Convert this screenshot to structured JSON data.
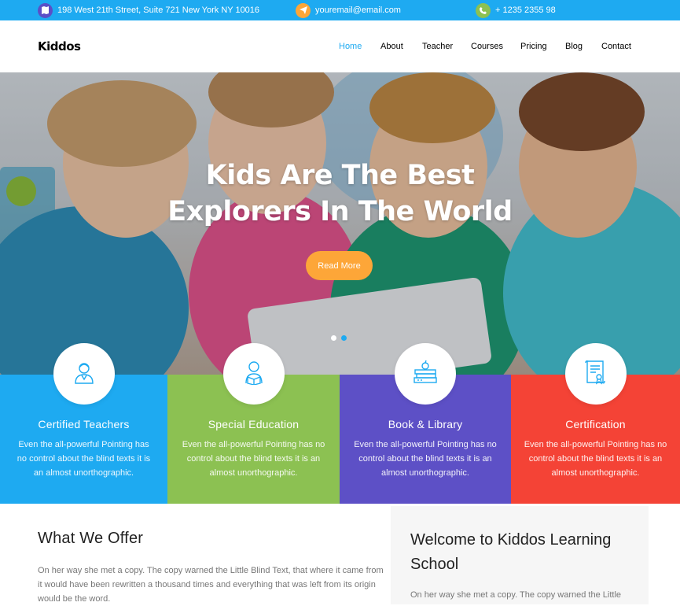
{
  "topbar": {
    "address": "198 West 21th Street, Suite 721 New York NY 10016",
    "email": "youremail@email.com",
    "phone": "+ 1235 2355 98",
    "icons": {
      "address": {
        "name": "map-icon",
        "color": "#5b4fc7"
      },
      "email": {
        "name": "paper-plane-icon",
        "color": "#fda638"
      },
      "phone": {
        "name": "phone-icon",
        "color": "#8cc152"
      }
    }
  },
  "navbar": {
    "brand": "Kiddos",
    "items": [
      {
        "label": "Home",
        "active": true
      },
      {
        "label": "About"
      },
      {
        "label": "Teacher"
      },
      {
        "label": "Courses"
      },
      {
        "label": "Pricing"
      },
      {
        "label": "Blog"
      },
      {
        "label": "Contact"
      }
    ]
  },
  "hero": {
    "title_line1": "Kids Are The Best",
    "title_line2": "Explorers In The World",
    "button": "Read More",
    "slide_count": 2,
    "active_slide": 2
  },
  "services": [
    {
      "title": "Certified Teachers",
      "text": "Even the all-powerful Pointing has no control about the blind texts it is an almost unorthographic.",
      "color": "#1eaaf1",
      "icon": "teacher-icon"
    },
    {
      "title": "Special Education",
      "text": "Even the all-powerful Pointing has no control about the blind texts it is an almost unorthographic.",
      "color": "#8cc152",
      "icon": "student-reading-icon"
    },
    {
      "title": "Book & Library",
      "text": "Even the all-powerful Pointing has no control about the blind texts it is an almost unorthographic.",
      "color": "#5d50c6",
      "icon": "books-apple-icon"
    },
    {
      "title": "Certification",
      "text": "Even the all-powerful Pointing has no control about the blind texts it is an almost unorthographic.",
      "color": "#f44336",
      "icon": "certificate-icon"
    }
  ],
  "offer": {
    "title": "What We Offer",
    "text": "On her way she met a copy. The copy warned the Little Blind Text, that where it came from it would have been rewritten a thousand times and everything that was left from its origin would be the word."
  },
  "welcome": {
    "title": "Welcome to Kiddos Learning School",
    "text": "On her way she met a copy. The copy warned the Little"
  }
}
